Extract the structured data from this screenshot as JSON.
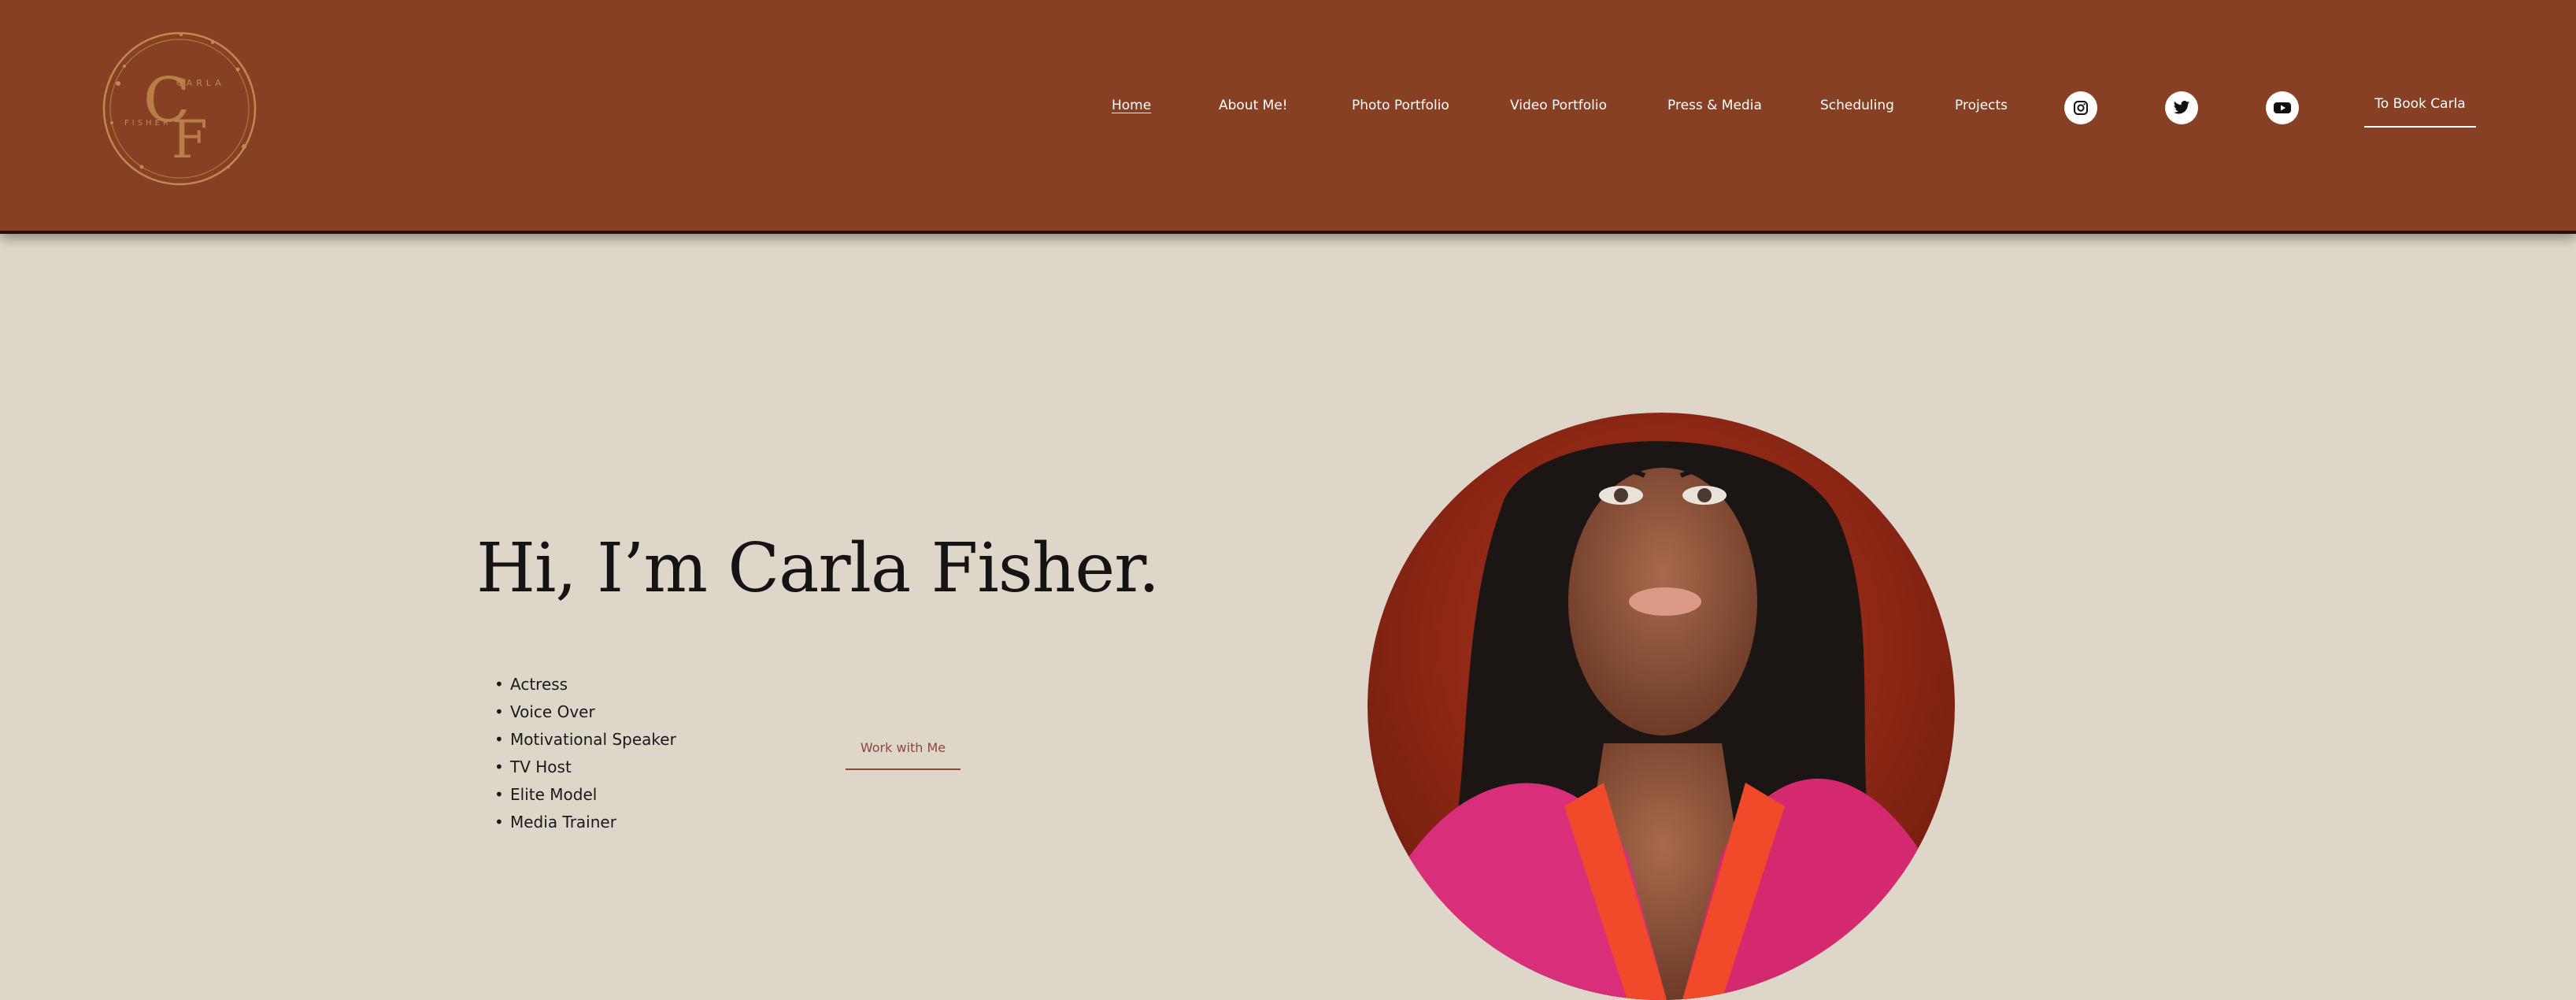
{
  "logo": {
    "letters": "CF",
    "text_top": "CARLA",
    "text_side": "FISHER",
    "gold": "#c08a4d"
  },
  "nav": {
    "links": [
      {
        "label": "Home"
      },
      {
        "label": "About Me!"
      },
      {
        "label": "Photo Portfolio"
      },
      {
        "label": "Video Portfolio"
      },
      {
        "label": "Press & Media"
      },
      {
        "label": "Scheduling"
      },
      {
        "label": "Projects"
      }
    ],
    "social": [
      "instagram-icon",
      "twitter-icon",
      "youtube-icon"
    ],
    "book_button": "To Book Carla"
  },
  "hero": {
    "title": "Hi, I’m Carla Fisher.",
    "roles": [
      "Actress",
      "Voice Over",
      "Motivational Speaker",
      "TV Host",
      "Elite Model",
      "Media Trainer"
    ],
    "cta": "Work with Me"
  },
  "colors": {
    "header_bg": "#874023",
    "page_bg": "#dfd6ca",
    "accent": "#8a4a35"
  }
}
